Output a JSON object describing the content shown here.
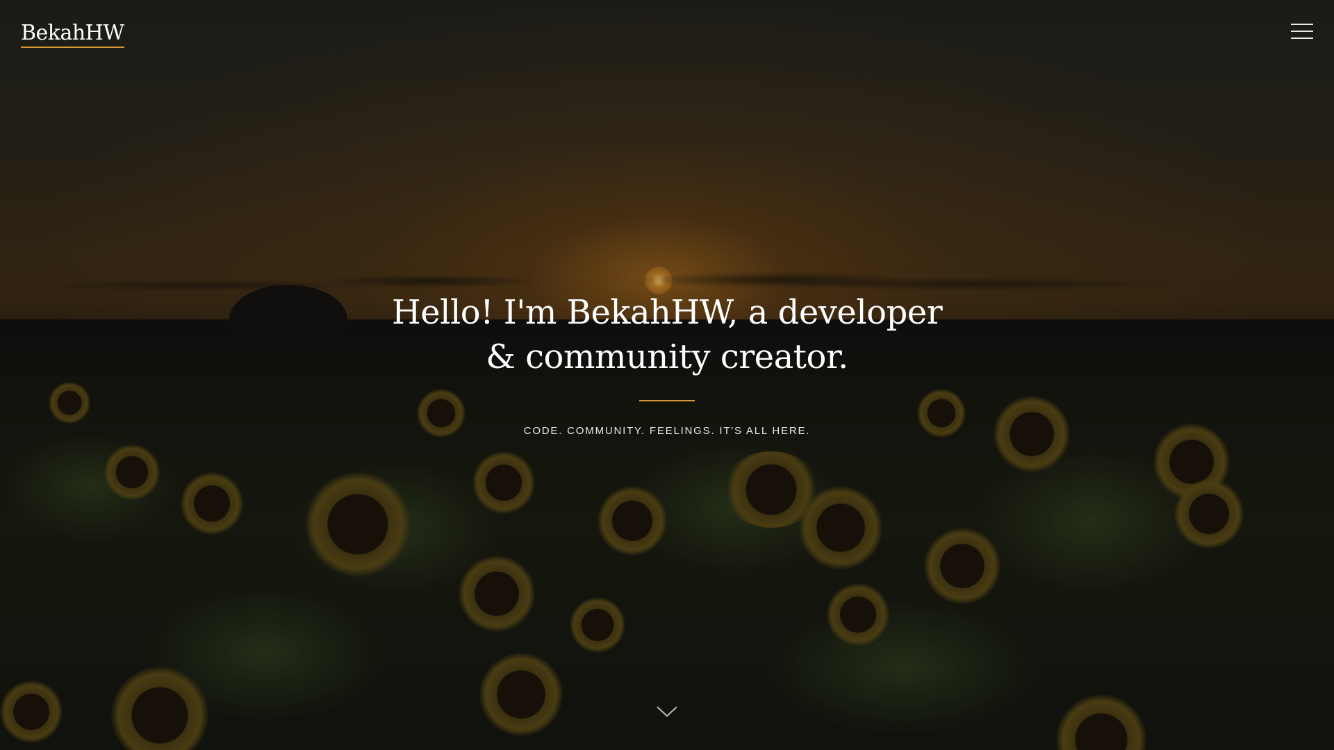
{
  "header": {
    "logo_text": "BekahHW",
    "menu_icon": "hamburger-menu-icon"
  },
  "hero": {
    "title_line1": "Hello! I'm BekahHW, a developer",
    "title_line2": "& community creator.",
    "tagline": "CODE. COMMUNITY. FEELINGS. IT'S ALL HERE.",
    "scroll_icon": "chevron-down-icon"
  },
  "colors": {
    "accent": "#d59a36",
    "text": "#ffffff",
    "background_dark": "#15150f"
  }
}
